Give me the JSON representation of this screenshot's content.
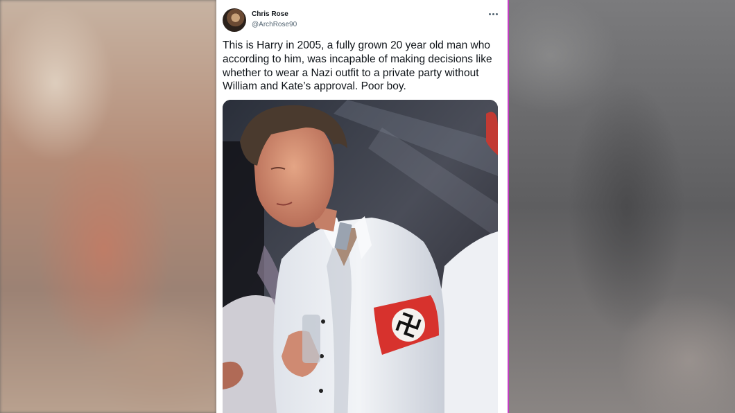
{
  "tweet": {
    "author": {
      "name": "Chris Rose",
      "handle": "@ArchRose90"
    },
    "text": "This is Harry in 2005, a fully grown 20 year old man who according to him, was incapable of making decisions like whether to wear a Nazi outfit to a private party without William and Kate’s approval. Poor boy.",
    "more_icon": "more-horizontal-icon"
  },
  "colors": {
    "text_primary": "#0f1419",
    "text_secondary": "#536471",
    "card_background": "#ffffff",
    "divider_accent": "#c23fc2"
  }
}
